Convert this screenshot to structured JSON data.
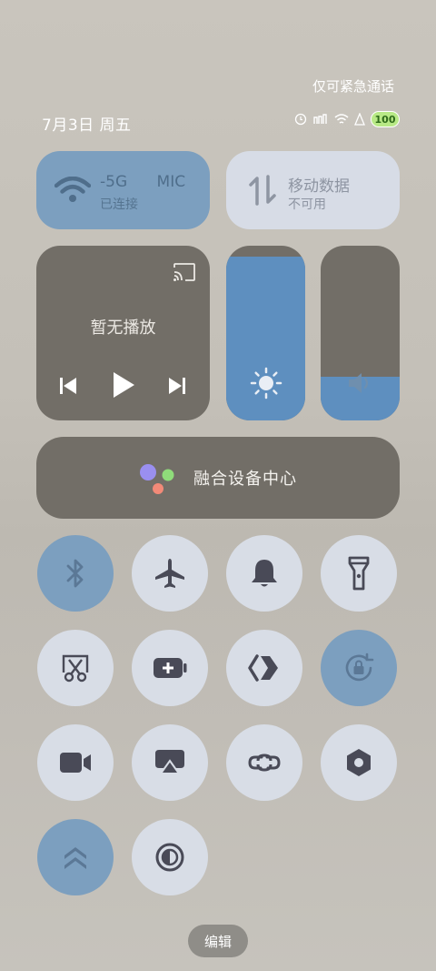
{
  "status": {
    "emergency_only": "仅可紧急通话",
    "date": "7月3日 周五",
    "battery_level": "100"
  },
  "wifi": {
    "network": "-5G      MIC",
    "state": "已连接",
    "active": true
  },
  "mobile_data": {
    "title": "移动数据",
    "state": "不可用",
    "active": false
  },
  "media": {
    "label": "暂无播放"
  },
  "sliders": {
    "brightness_level": 0.94,
    "volume_level": 0.25
  },
  "device_center": {
    "label": "融合设备中心"
  },
  "toggles": [
    {
      "name": "bluetooth",
      "icon": "bluetooth-icon",
      "active": true
    },
    {
      "name": "airplane-mode",
      "icon": "airplane-icon",
      "active": false
    },
    {
      "name": "ring-mode",
      "icon": "bell-icon",
      "active": false
    },
    {
      "name": "flashlight",
      "icon": "flashlight-icon",
      "active": false
    },
    {
      "name": "screenshot",
      "icon": "scissors-icon",
      "active": false
    },
    {
      "name": "battery-saver",
      "icon": "battery-plus-icon",
      "active": false
    },
    {
      "name": "share",
      "icon": "share-arrow-icon",
      "active": false
    },
    {
      "name": "rotation-lock",
      "icon": "rotation-lock-icon",
      "active": true
    },
    {
      "name": "screen-record",
      "icon": "video-camera-icon",
      "active": false
    },
    {
      "name": "screen-cast",
      "icon": "screen-cast-icon",
      "active": false
    },
    {
      "name": "link",
      "icon": "link-icon",
      "active": false
    },
    {
      "name": "nfc",
      "icon": "hexagon-icon",
      "active": false
    },
    {
      "name": "performance",
      "icon": "double-chevron-up-icon",
      "active": true
    },
    {
      "name": "dark-mode",
      "icon": "contrast-icon",
      "active": false
    }
  ],
  "footer": {
    "edit_label": "编辑"
  },
  "colors": {
    "active": "#7c9fbf",
    "inactive": "#d8dde6",
    "dark_tile": "#726e67",
    "slider_fill": "#5e8fbf"
  }
}
